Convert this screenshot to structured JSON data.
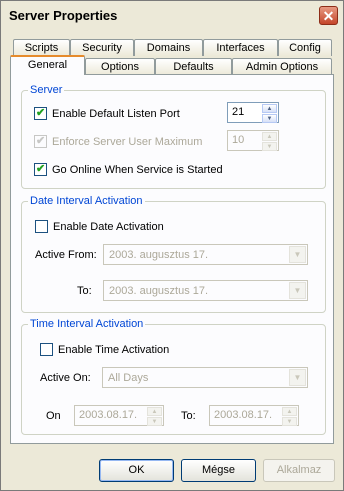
{
  "window": {
    "title": "Server Properties",
    "close_glyph": "✕"
  },
  "tabs_row_back": [
    {
      "label": "Scripts"
    },
    {
      "label": "Security"
    },
    {
      "label": "Domains"
    },
    {
      "label": "Interfaces"
    },
    {
      "label": "Config"
    }
  ],
  "tabs_row_front": [
    {
      "label": "General",
      "active": true
    },
    {
      "label": "Options"
    },
    {
      "label": "Defaults"
    },
    {
      "label": "Admin Options"
    }
  ],
  "server_group": {
    "legend": "Server",
    "enable_default_listen_port": {
      "label": "Enable Default Listen Port",
      "checked": true
    },
    "listen_port": "21",
    "enforce_server_user_maximum": {
      "label": "Enforce Server User Maximum",
      "checked": true,
      "disabled": true
    },
    "user_maximum": "10",
    "go_online": {
      "label": "Go Online When Service is Started",
      "checked": true
    }
  },
  "date_group": {
    "legend": "Date Interval Activation",
    "enable_date_activation": {
      "label": "Enable Date Activation",
      "checked": false
    },
    "active_from_label": "Active From:",
    "active_from_value": "2003.  augusztus  17.",
    "to_label": "To:",
    "to_value": "2003.  augusztus  17."
  },
  "time_group": {
    "legend": "Time Interval Activation",
    "enable_time_activation": {
      "label": "Enable Time Activation",
      "checked": false
    },
    "active_on_label": "Active On:",
    "active_on_value": "All Days",
    "on_label": "On",
    "on_value": "2003.08.17.",
    "to_label": "To:",
    "to_value": "2003.08.17."
  },
  "buttons": {
    "ok": "OK",
    "cancel": "Mégse",
    "apply": "Alkalmaz"
  },
  "glyphs": {
    "check": "✔",
    "up": "▲",
    "down": "▼"
  },
  "colors": {
    "accent_tab": "#e68b2c",
    "legend_text": "#0046d5",
    "check_green": "#21a121",
    "close_red": "#c4462a"
  }
}
